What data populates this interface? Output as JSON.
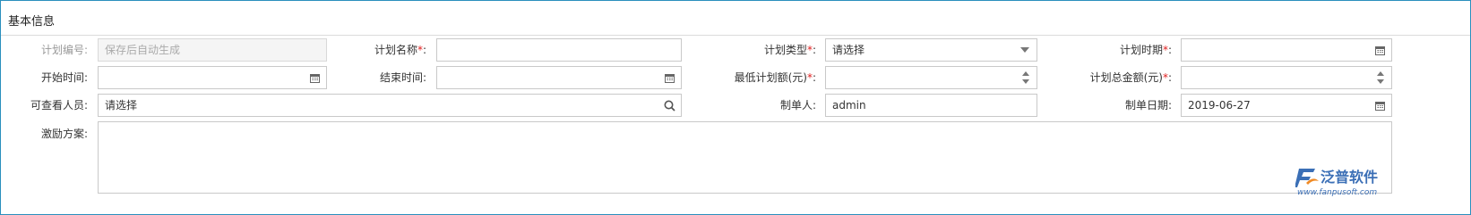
{
  "panel": {
    "title": "基本信息"
  },
  "fields": {
    "plan_no": {
      "label": "计划编号:",
      "placeholder": "保存后自动生成"
    },
    "plan_name": {
      "label": "计划名称",
      "required": "*",
      "colon": ":",
      "value": ""
    },
    "plan_type": {
      "label": "计划类型",
      "required": "*",
      "colon": ":",
      "value": "请选择"
    },
    "plan_period": {
      "label": "计划时期",
      "required": "*",
      "colon": ":",
      "value": ""
    },
    "start_time": {
      "label": "开始时间:",
      "value": ""
    },
    "end_time": {
      "label": "结束时间:",
      "value": ""
    },
    "min_amount": {
      "label": "最低计划额(元)",
      "required": "*",
      "colon": ":",
      "value": ""
    },
    "total_amount": {
      "label": "计划总金额(元)",
      "required": "*",
      "colon": ":",
      "value": ""
    },
    "viewers": {
      "label": "可查看人员:",
      "value": "请选择"
    },
    "creator": {
      "label": "制单人:",
      "value": "admin"
    },
    "create_date": {
      "label": "制单日期:",
      "value": "2019-06-27"
    },
    "incentive": {
      "label": "激励方案:",
      "value": ""
    }
  },
  "logo": {
    "name": "泛普软件",
    "url": "www.fanpusoft.com"
  },
  "colors": {
    "border_accent": "#2a8fbd",
    "required": "#e02020",
    "logo_blue": "#3b6fb6",
    "logo_orange": "#f08a24"
  }
}
